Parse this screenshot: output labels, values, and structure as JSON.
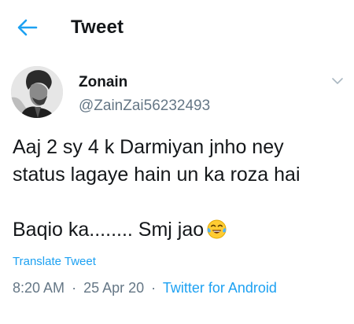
{
  "header": {
    "title": "Tweet"
  },
  "author": {
    "display_name": "Zonain",
    "handle": "@ZainZai56232493"
  },
  "tweet": {
    "line1": "Aaj 2 sy 4 k Darmiyan jnho ney",
    "line2": "status lagaye hain un ka roza hai",
    "line3": "Baqio ka........ Smj jao",
    "emoji": "face-with-tears-of-joy-icon"
  },
  "translate": {
    "label": "Translate Tweet"
  },
  "meta": {
    "time": "8:20 AM",
    "sep1": "·",
    "date": "25 Apr 20",
    "sep2": "·",
    "source": "Twitter for Android"
  },
  "colors": {
    "accent": "#1da1f2",
    "text": "#14171a",
    "muted": "#657786"
  }
}
